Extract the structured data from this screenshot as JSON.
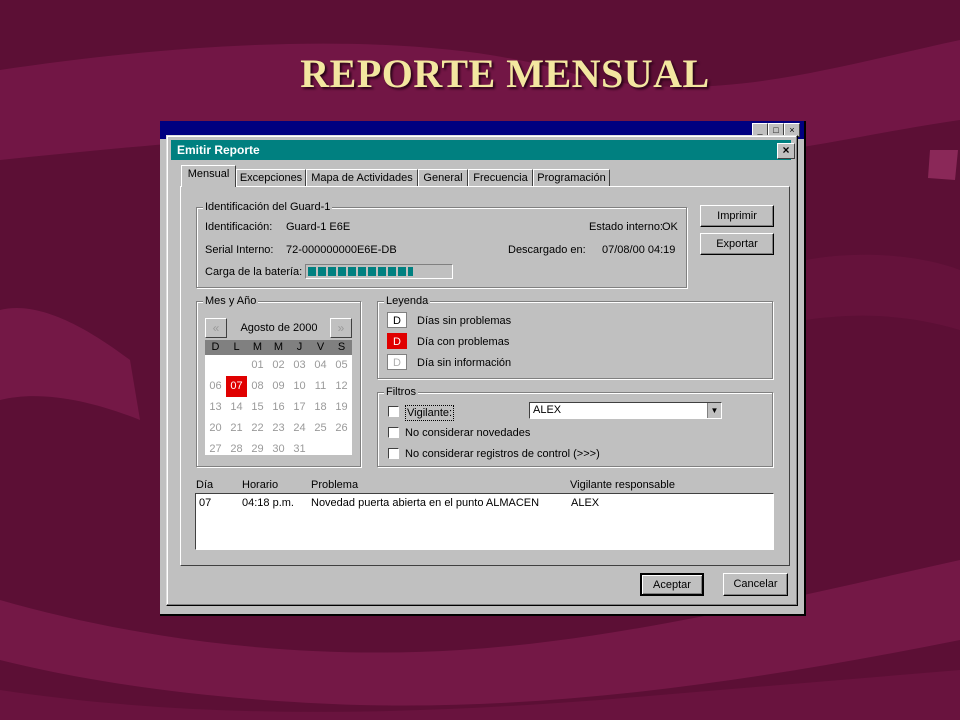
{
  "slide": {
    "title": "REPORTE MENSUAL"
  },
  "colors": {
    "background": "#5c0f35",
    "dialog_title_bar": "#008080",
    "today_highlight": "#e00000"
  },
  "dialog": {
    "title": "Emitir Reporte",
    "close_icon": "close-icon",
    "tabs": [
      "Mensual",
      "Excepciones",
      "Mapa de Actividades",
      "General",
      "Frecuencia",
      "Programación"
    ],
    "identification": {
      "group_label": "Identificación del Guard-1",
      "id_label": "Identificación:",
      "id_value": "Guard-1 E6E",
      "state_label": "Estado interno:",
      "state_value": "OK",
      "serial_label": "Serial Interno:",
      "serial_value": "72-000000000E6E-DB",
      "downloaded_label": "Descargado en:",
      "downloaded_value": "07/08/00 04:19",
      "battery_label": "Carga de la batería:",
      "battery_level": 0.74
    },
    "buttons": {
      "print": "Imprimir",
      "export": "Exportar",
      "accept": "Aceptar",
      "cancel": "Cancelar"
    },
    "calendar": {
      "group_label": "Mes y Año",
      "month_label": "Agosto de 2000",
      "prev_icon": "double-chevron-left-icon",
      "next_icon": "double-chevron-right-icon",
      "weekdays": [
        "D",
        "L",
        "M",
        "M",
        "J",
        "V",
        "S"
      ],
      "days": [
        "",
        "",
        "01",
        "02",
        "03",
        "04",
        "05",
        "06",
        "07",
        "08",
        "09",
        "10",
        "11",
        "12",
        "13",
        "14",
        "15",
        "16",
        "17",
        "18",
        "19",
        "20",
        "21",
        "22",
        "23",
        "24",
        "25",
        "26",
        "27",
        "28",
        "29",
        "30",
        "31"
      ],
      "selected_day": "07"
    },
    "legend": {
      "group_label": "Leyenda",
      "items": [
        {
          "mark": "D",
          "label": "Días sin problemas"
        },
        {
          "mark": "D",
          "label": "Día con problemas"
        },
        {
          "mark": "D",
          "label": "Día sin información"
        }
      ]
    },
    "filters": {
      "group_label": "Filtros",
      "guard_label": "Vigilante:",
      "guard_value": "ALEX",
      "no_news_label": "No considerar novedades",
      "no_control_label": "No considerar registros de control (>>>)"
    },
    "table": {
      "headers": [
        "Día",
        "Horario",
        "Problema",
        "Vigilante responsable"
      ],
      "rows": [
        {
          "day": "07",
          "time": "04:18 p.m.",
          "problem": "Novedad puerta abierta en el punto ALMACEN",
          "guard": "ALEX"
        }
      ]
    }
  }
}
